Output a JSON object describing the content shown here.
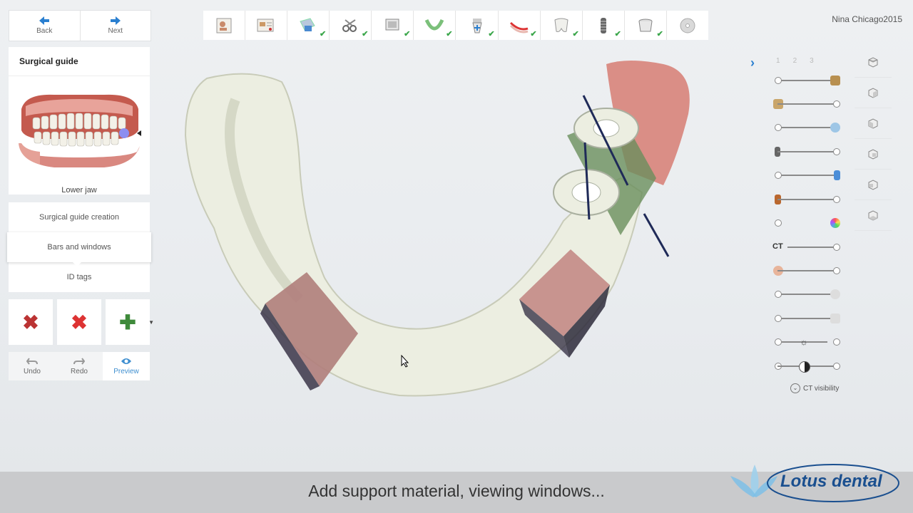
{
  "nav": {
    "back": "Back",
    "next": "Next"
  },
  "panel": {
    "title": "Surgical guide",
    "jaw_label": "Lower jaw"
  },
  "steps": [
    "Surgical guide creation",
    "Bars and windows",
    "ID tags"
  ],
  "tools": {
    "remove_cross": "✖",
    "remove_red": "✖",
    "add": "✚"
  },
  "undo_bar": {
    "undo": "Undo",
    "redo": "Redo",
    "preview": "Preview"
  },
  "user": "Nina Chicago2015",
  "pages": [
    "1",
    "2",
    "3"
  ],
  "ct_label": "CT",
  "ct_visibility": "CT visibility",
  "caption": "Add support material, viewing windows...",
  "logo": "Lotus dental",
  "colors": {
    "accent": "#2a7fd0",
    "check": "#3aa64a",
    "gum": "#d98880",
    "model": "#ecefe2"
  }
}
